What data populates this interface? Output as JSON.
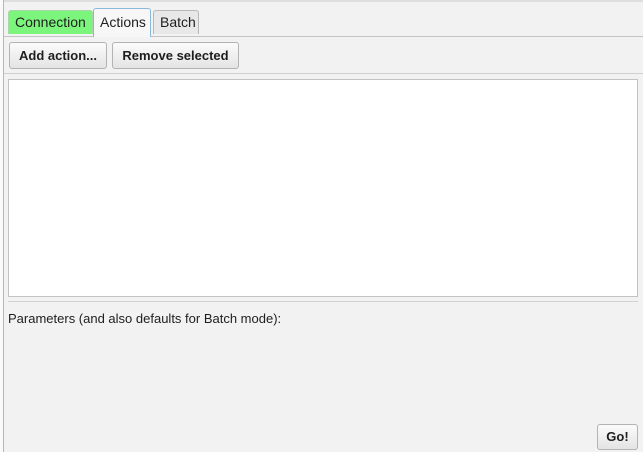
{
  "tabs": [
    {
      "label": "Connection"
    },
    {
      "label": "Actions"
    },
    {
      "label": "Batch"
    }
  ],
  "toolbar": {
    "add_label": "Add action...",
    "remove_label": "Remove selected"
  },
  "actions_list": {
    "items": []
  },
  "params": {
    "label": "Parameters (and also defaults for Batch mode):"
  },
  "go_label": "Go!",
  "colors": {
    "connection_tab": "#7cf57c",
    "window_bg": "#f2f2f2",
    "list_bg": "#ffffff"
  }
}
